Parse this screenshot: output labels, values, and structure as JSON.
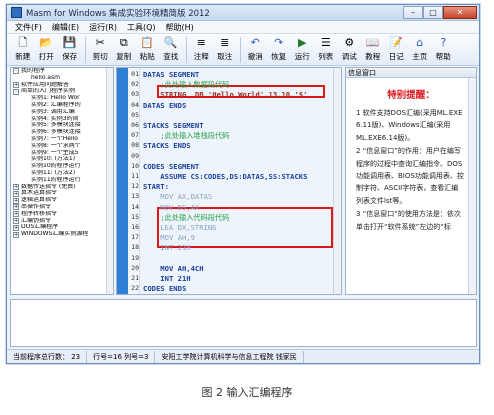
{
  "window": {
    "title": "Masm for Windows 集成实验环境精简版 2012"
  },
  "menu": [
    "文件(F)",
    "编辑(E)",
    "运行(R)",
    "工具(Q)",
    "帮助(H)"
  ],
  "toolbar": [
    {
      "label": "新建",
      "icon": "new-file-icon"
    },
    {
      "label": "打开",
      "icon": "open-folder-icon"
    },
    {
      "label": "保存",
      "icon": "save-icon"
    },
    {
      "label": "剪切",
      "icon": "cut-icon"
    },
    {
      "label": "复制",
      "icon": "copy-icon"
    },
    {
      "label": "粘贴",
      "icon": "paste-icon"
    },
    {
      "label": "查找",
      "icon": "find-icon"
    },
    {
      "label": "注释",
      "icon": "comment-icon"
    },
    {
      "label": "取注",
      "icon": "uncomment-icon"
    },
    {
      "label": "撤消",
      "icon": "undo-icon"
    },
    {
      "label": "恢复",
      "icon": "redo-icon"
    },
    {
      "label": "运行",
      "icon": "run-icon"
    },
    {
      "label": "列表",
      "icon": "list-icon"
    },
    {
      "label": "调试",
      "icon": "debug-icon"
    },
    {
      "label": "教程",
      "icon": "tutorial-icon"
    },
    {
      "label": "日记",
      "icon": "diary-icon"
    },
    {
      "label": "主页",
      "icon": "home-icon"
    },
    {
      "label": "帮助",
      "icon": "help-icon"
    }
  ],
  "tree": [
    {
      "text": "我的程序",
      "level": 0,
      "exp": "-"
    },
    {
      "text": "hello.asm",
      "level": 1,
      "exp": ""
    },
    {
      "text": "软件应用问题解答",
      "level": 0,
      "exp": "+"
    },
    {
      "text": "简单的入门程序实例",
      "level": 0,
      "exp": "-"
    },
    {
      "text": "实例1: Hello Wor",
      "level": 1,
      "exp": ""
    },
    {
      "text": "实例2: 汇编程序的",
      "level": 1,
      "exp": ""
    },
    {
      "text": "实例3: 调用汇编",
      "level": 1,
      "exp": ""
    },
    {
      "text": "实例4: 实例3的简",
      "level": 1,
      "exp": ""
    },
    {
      "text": "实例5: 多模块连接",
      "level": 1,
      "exp": ""
    },
    {
      "text": "实例6: 多模块连接",
      "level": 1,
      "exp": ""
    },
    {
      "text": "实例7: 一个Hello",
      "level": 1,
      "exp": ""
    },
    {
      "text": "实例8: 一个求两个",
      "level": 1,
      "exp": ""
    },
    {
      "text": "实例9: 一个生成5",
      "level": 1,
      "exp": ""
    },
    {
      "text": "实例10: (方法1)",
      "level": 1,
      "exp": ""
    },
    {
      "text": "实例10的程序运行",
      "level": 1,
      "exp": ""
    },
    {
      "text": "实例11: (方法2)",
      "level": 1,
      "exp": ""
    },
    {
      "text": "实例11的程序运行",
      "level": 1,
      "exp": ""
    },
    {
      "text": "数据传送指令 (免费)",
      "level": 0,
      "exp": "+"
    },
    {
      "text": "算术运算指令",
      "level": 0,
      "exp": "+"
    },
    {
      "text": "逻辑运算指令",
      "level": 0,
      "exp": "+"
    },
    {
      "text": "串操作指令",
      "level": 0,
      "exp": "+"
    },
    {
      "text": "程序转移指令",
      "level": 0,
      "exp": "+"
    },
    {
      "text": "汇编伪指令",
      "level": 0,
      "exp": "+"
    },
    {
      "text": "DOS汇编程序",
      "level": 0,
      "exp": "+"
    },
    {
      "text": "WINDOWS汇编实例源程",
      "level": 0,
      "exp": "+"
    }
  ],
  "editor": {
    "line_numbers": [
      "01",
      "02",
      "03",
      "04",
      "05",
      "06",
      "07",
      "08",
      "09",
      "10",
      "11",
      "12",
      "13",
      "14",
      "15",
      "16",
      "17",
      "18",
      "19",
      "20",
      "21",
      "22"
    ],
    "lines": [
      {
        "text": "DATAS SEGMENT",
        "style": "kw"
      },
      {
        "text": "    ;此处输入数据段代码",
        "style": "comment"
      },
      {
        "text": "    STRING  DB 'Hello World',13,10,'$'",
        "style": "str"
      },
      {
        "text": "DATAS ENDS",
        "style": "kw"
      },
      {
        "text": "",
        "style": "kw"
      },
      {
        "text": "STACKS SEGMENT",
        "style": "kw"
      },
      {
        "text": "    ;此处输入堆栈段代码",
        "style": "comment"
      },
      {
        "text": "STACKS ENDS",
        "style": "kw"
      },
      {
        "text": "",
        "style": "kw"
      },
      {
        "text": "CODES SEGMENT",
        "style": "kw"
      },
      {
        "text": "    ASSUME CS:CODES,DS:DATAS,SS:STACKS",
        "style": "kw"
      },
      {
        "text": "START:",
        "style": "kw"
      },
      {
        "text": "    MOV AX,DATAS",
        "style": "faded"
      },
      {
        "text": "    MOV DS,AX",
        "style": "faded"
      },
      {
        "text": "    ;此处输入代码段代码",
        "style": "comment"
      },
      {
        "text": "    LEA DX,STRING",
        "style": "faded"
      },
      {
        "text": "    MOV AH,9",
        "style": "faded"
      },
      {
        "text": "    INT 21H",
        "style": "faded"
      },
      {
        "text": "",
        "style": "kw"
      },
      {
        "text": "    MOV AH,4CH",
        "style": "kw"
      },
      {
        "text": "    INT 21H",
        "style": "kw"
      },
      {
        "text": "CODES ENDS",
        "style": "kw"
      }
    ]
  },
  "info_panel": {
    "header": "信息窗口",
    "title": "特别提醒：",
    "paragraphs": [
      "1 软件支持DOS汇编(采用ML.EXE 6.11版)、Windows汇编(采用ML.EXE6.14版)。",
      "2 “信息窗口”的作用：用户在编写程序的过程中查询汇编指令、DOS功能调用表、BIOS功能调用表、控制字符、ASCII字符表，查看汇编列表文件lst等。",
      "3 “信息窗口”的使用方法是：依次单击打开“软件系统”左边的“标"
    ]
  },
  "status": {
    "total_programs": "当前程序总行数： 23",
    "cursor": "行号=16  列号=3",
    "author": "安阳工学院计算机科学与信息工程院  钱家民"
  },
  "caption": "图 2 输入汇编程序",
  "colors": {
    "highlight_box": "#d9171d",
    "keyword": "#1d3f9e",
    "comment": "#2aa14a",
    "gutter": "#2f7fd6"
  }
}
